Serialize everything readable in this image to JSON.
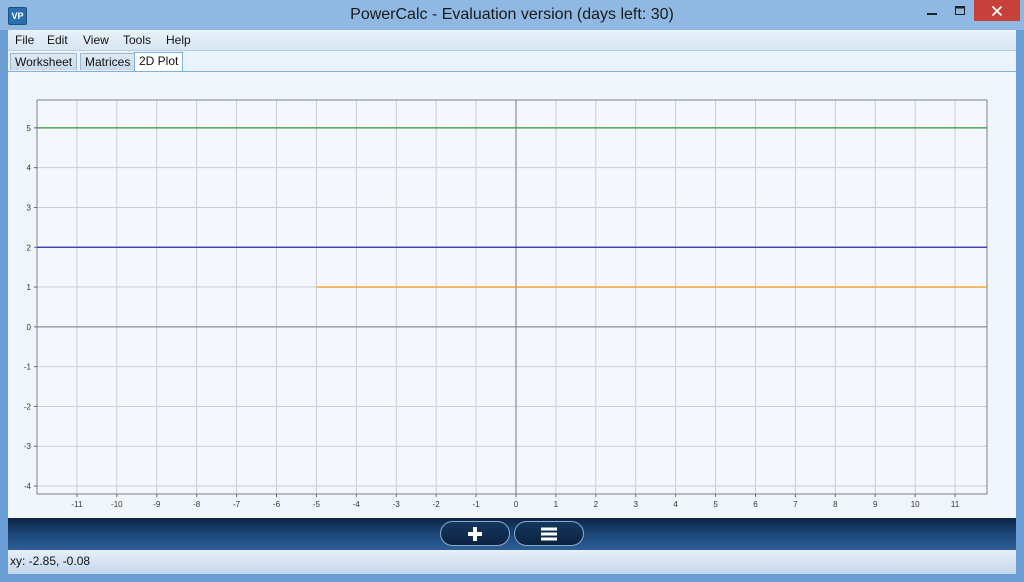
{
  "window": {
    "title": "PowerCalc - Evaluation version (days left: 30)",
    "icon": "vp-app-icon",
    "icon_text": "VP"
  },
  "menu": {
    "items": [
      "File",
      "Edit",
      "View",
      "Tools",
      "Help"
    ]
  },
  "tabs": {
    "items": [
      "Worksheet",
      "Matrices",
      "2D Plot"
    ],
    "active": "2D Plot"
  },
  "toolbar": {
    "add_icon": "plus-icon",
    "list_icon": "list-icon"
  },
  "status": {
    "coords": "xy: -2.85, -0.08"
  },
  "chart_data": {
    "type": "line",
    "title": "",
    "xlabel": "",
    "ylabel": "",
    "xlim": [
      -12,
      11.8
    ],
    "ylim": [
      -4.2,
      5.7
    ],
    "x_ticks": [
      -11,
      -10,
      -9,
      -8,
      -7,
      -6,
      -5,
      -4,
      -3,
      -2,
      -1,
      0,
      1,
      2,
      3,
      4,
      5,
      6,
      7,
      8,
      9,
      10,
      11
    ],
    "y_ticks": [
      -4,
      -3,
      -2,
      -1,
      0,
      1,
      2,
      3,
      4,
      5
    ],
    "grid": true,
    "series": [
      {
        "color": "#2e9b2e",
        "x": [
          -12,
          11.8
        ],
        "y": [
          5,
          5
        ]
      },
      {
        "color": "#2a2aa8",
        "x": [
          -12,
          11.8
        ],
        "y": [
          2,
          2
        ]
      },
      {
        "color": "#f0a020",
        "x": [
          -5,
          11.8
        ],
        "y": [
          1,
          1
        ]
      }
    ]
  }
}
